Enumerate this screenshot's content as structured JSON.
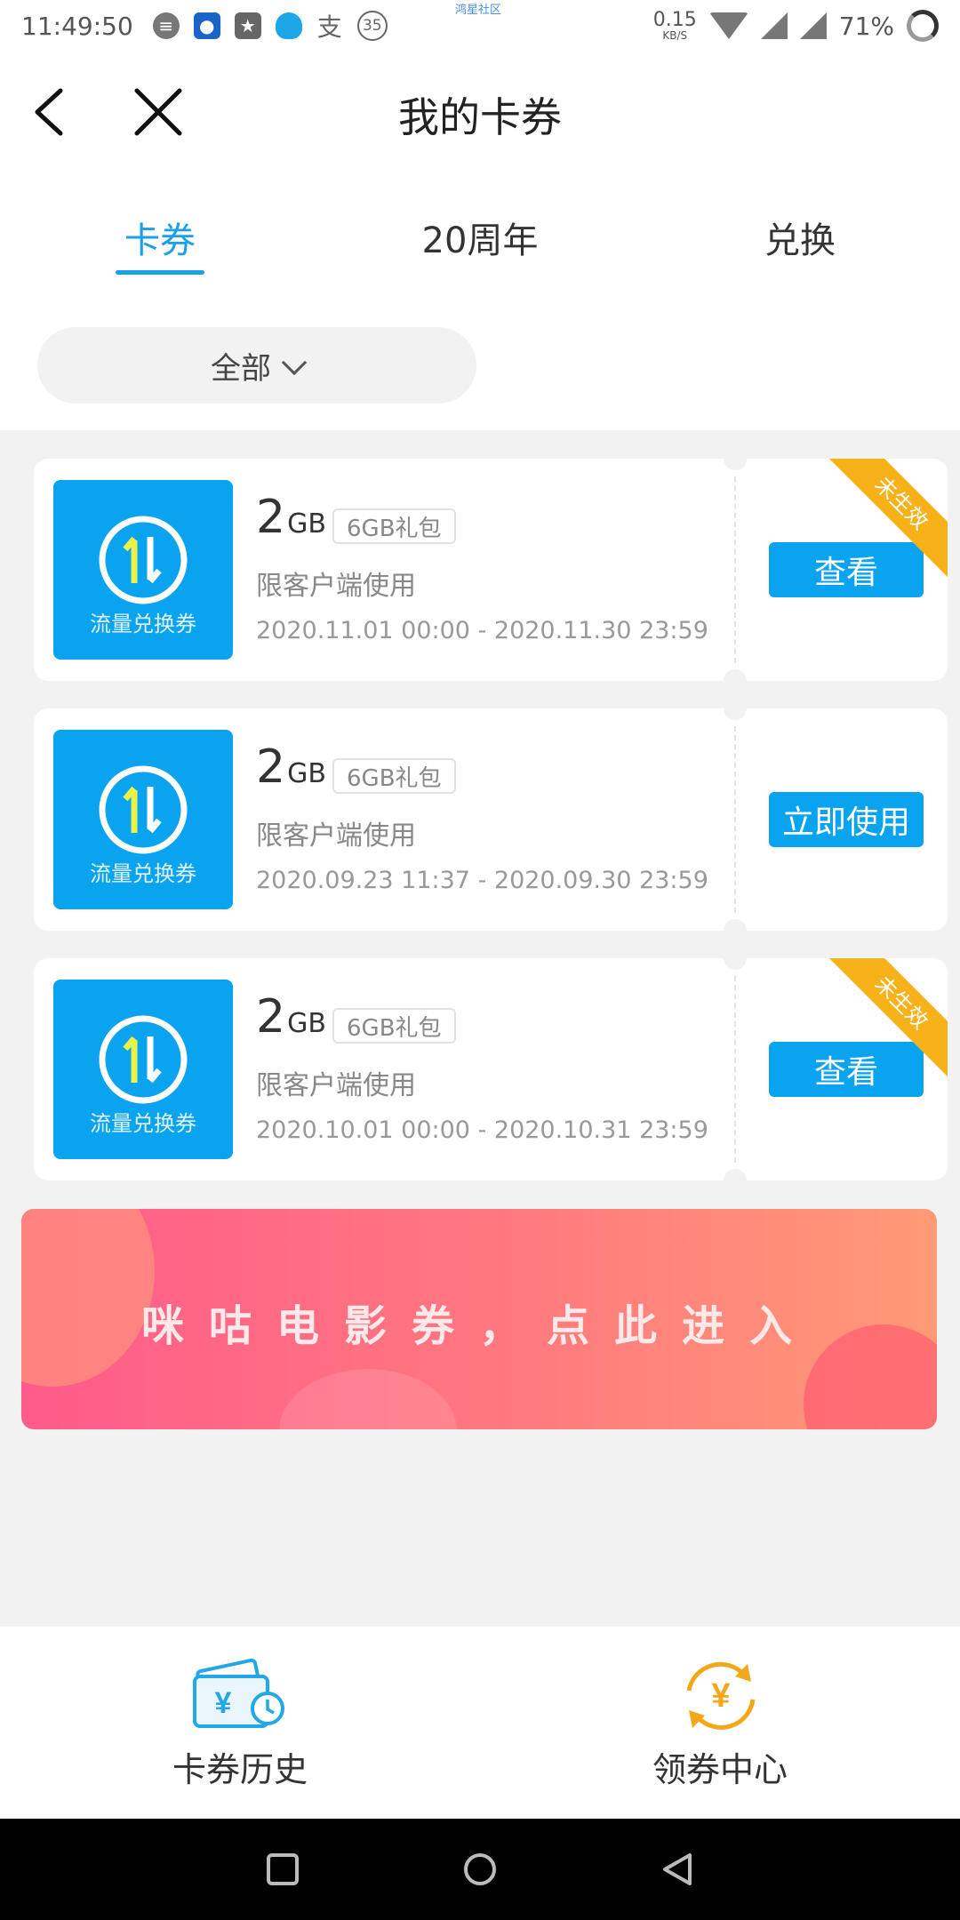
{
  "status_bar": {
    "time": "11:49:50",
    "notification_count": "35",
    "center_text": "鸿星社区",
    "net_speed": "0.15",
    "net_speed_unit": "KB/S",
    "battery": "71%"
  },
  "header": {
    "title": "我的卡券"
  },
  "tabs": [
    {
      "label": "卡券",
      "active": true
    },
    {
      "label": "20周年",
      "active": false
    },
    {
      "label": "兑换",
      "active": false
    }
  ],
  "filter": {
    "selected": "全部"
  },
  "coupons": [
    {
      "icon_label": "流量兑换券",
      "amount": "2",
      "unit": "GB",
      "package": "6GB礼包",
      "restriction": "限客户端使用",
      "validity": "2020.11.01 00:00 - 2020.11.30 23:59",
      "action": "查看",
      "ribbon": "未生效"
    },
    {
      "icon_label": "流量兑换券",
      "amount": "2",
      "unit": "GB",
      "package": "6GB礼包",
      "restriction": "限客户端使用",
      "validity": "2020.09.23 11:37 - 2020.09.30 23:59",
      "action": "立即使用"
    },
    {
      "icon_label": "流量兑换券",
      "amount": "2",
      "unit": "GB",
      "package": "6GB礼包",
      "restriction": "限客户端使用",
      "validity": "2020.10.01 00:00 - 2020.10.31 23:59",
      "action": "查看",
      "ribbon": "未生效"
    }
  ],
  "banner": {
    "text": "咪咕电影券，点此进入"
  },
  "bottom_nav": [
    {
      "label": "卡券历史",
      "icon": "wallet-clock-icon"
    },
    {
      "label": "领券中心",
      "icon": "yuan-exchange-icon"
    }
  ],
  "colors": {
    "accent": "#0aa3ef",
    "tab_active": "#1aa0e6",
    "ribbon": "#f7b21a",
    "banner_start": "#ff5b8a",
    "banner_end": "#ff9a76"
  }
}
